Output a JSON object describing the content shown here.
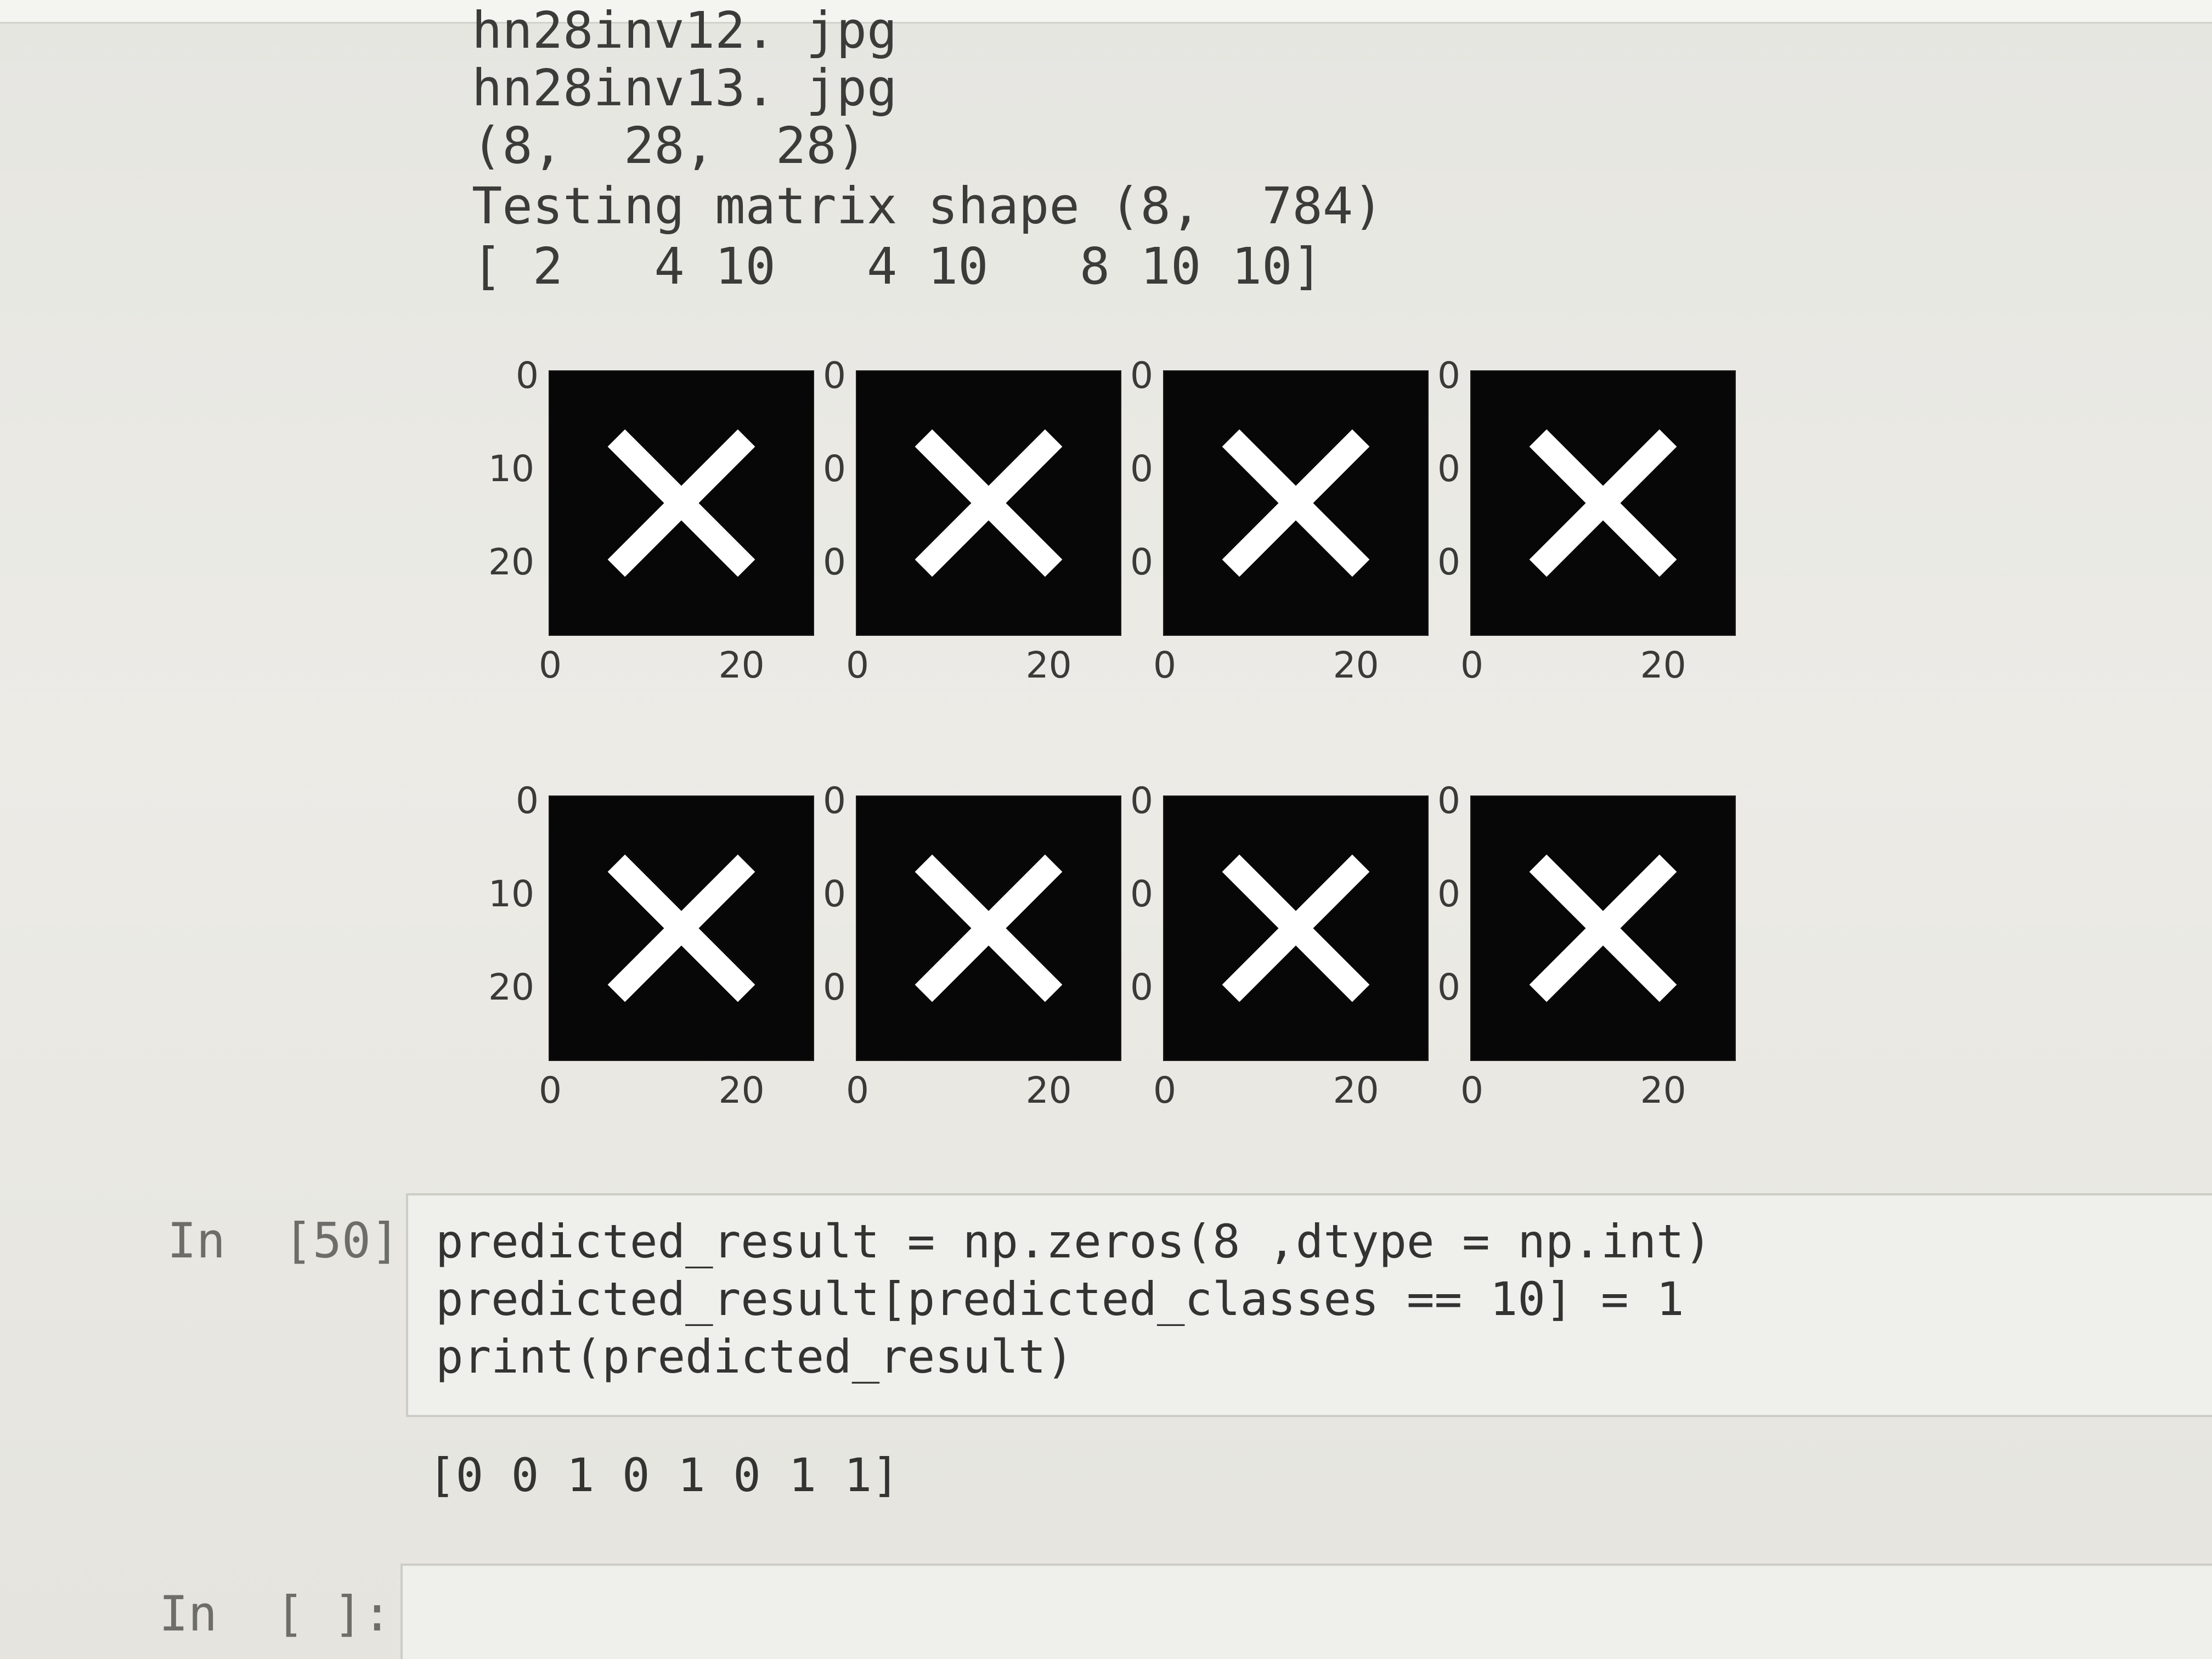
{
  "output_lines": [
    "hn28inv12. jpg",
    "hn28inv13. jpg",
    "(8,  28,  28)",
    "Testing matrix shape (8,  784)",
    "[ 2   4 10   4 10   8 10 10]"
  ],
  "figure": {
    "subplots_row1": [
      {
        "y_ticks": [
          "0",
          "10",
          "20"
        ],
        "x_ticks": [
          "0",
          "20"
        ]
      },
      {
        "y_ticks": [
          "0",
          "0",
          "0"
        ],
        "x_ticks": [
          "0",
          "20"
        ]
      },
      {
        "y_ticks": [
          "0",
          "0",
          "0"
        ],
        "x_ticks": [
          "0",
          "20"
        ]
      },
      {
        "y_ticks": [
          "0",
          "0",
          "0"
        ],
        "x_ticks": [
          "0",
          "20"
        ]
      }
    ],
    "subplots_row2": [
      {
        "y_ticks": [
          "0",
          "10",
          "20"
        ],
        "x_ticks": [
          "0",
          "20"
        ]
      },
      {
        "y_ticks": [
          "0",
          "0",
          "0"
        ],
        "x_ticks": [
          "0",
          "20"
        ]
      },
      {
        "y_ticks": [
          "0",
          "0",
          "0"
        ],
        "x_ticks": [
          "0",
          "20"
        ]
      },
      {
        "y_ticks": [
          "0",
          "0",
          "0"
        ],
        "x_ticks": [
          "0",
          "20"
        ]
      }
    ],
    "image_glyph": "X",
    "image_color": "#ffffff",
    "background_color": "#070707"
  },
  "cell_50": {
    "prompt": "In  [50]:",
    "code": [
      "predicted_result = np.zeros(8 ,dtype = np.int)",
      "predicted_result[predicted_classes == 10] = 1",
      "print(predicted_result)"
    ],
    "output": "[0 0 1 0 1 0 1 1]"
  },
  "empty_cell": {
    "prompt": "In  [ ]:"
  }
}
